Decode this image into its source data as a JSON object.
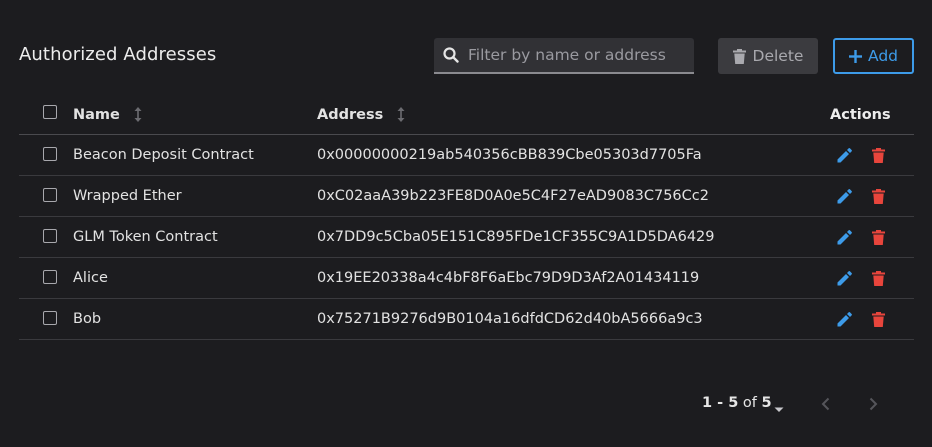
{
  "header": {
    "title": "Authorized Addresses",
    "search_placeholder": "Filter by name or address",
    "delete_label": "Delete",
    "add_label": "Add"
  },
  "table": {
    "columns": {
      "name": "Name",
      "address": "Address",
      "actions": "Actions"
    },
    "rows": [
      {
        "name": "Beacon Deposit Contract",
        "address": "0x00000000219ab540356cBB839Cbe05303d7705Fa"
      },
      {
        "name": "Wrapped Ether",
        "address": "0xC02aaA39b223FE8D0A0e5C4F27eAD9083C756Cc2"
      },
      {
        "name": "GLM Token Contract",
        "address": "0x7DD9c5Cba05E151C895FDe1CF355C9A1D5DA6429"
      },
      {
        "name": "Alice",
        "address": "0x19EE20338a4c4bF8F6aEbc79D9D3Af2A01434119"
      },
      {
        "name": "Bob",
        "address": "0x75271B9276d9B0104a16dfdCD62d40bA5666a9c3"
      }
    ]
  },
  "pagination": {
    "range": "1 - 5",
    "of_label": "of",
    "total": "5"
  },
  "colors": {
    "background": "#1c1c1f",
    "accent": "#3d9be9",
    "danger": "#e8453c"
  }
}
